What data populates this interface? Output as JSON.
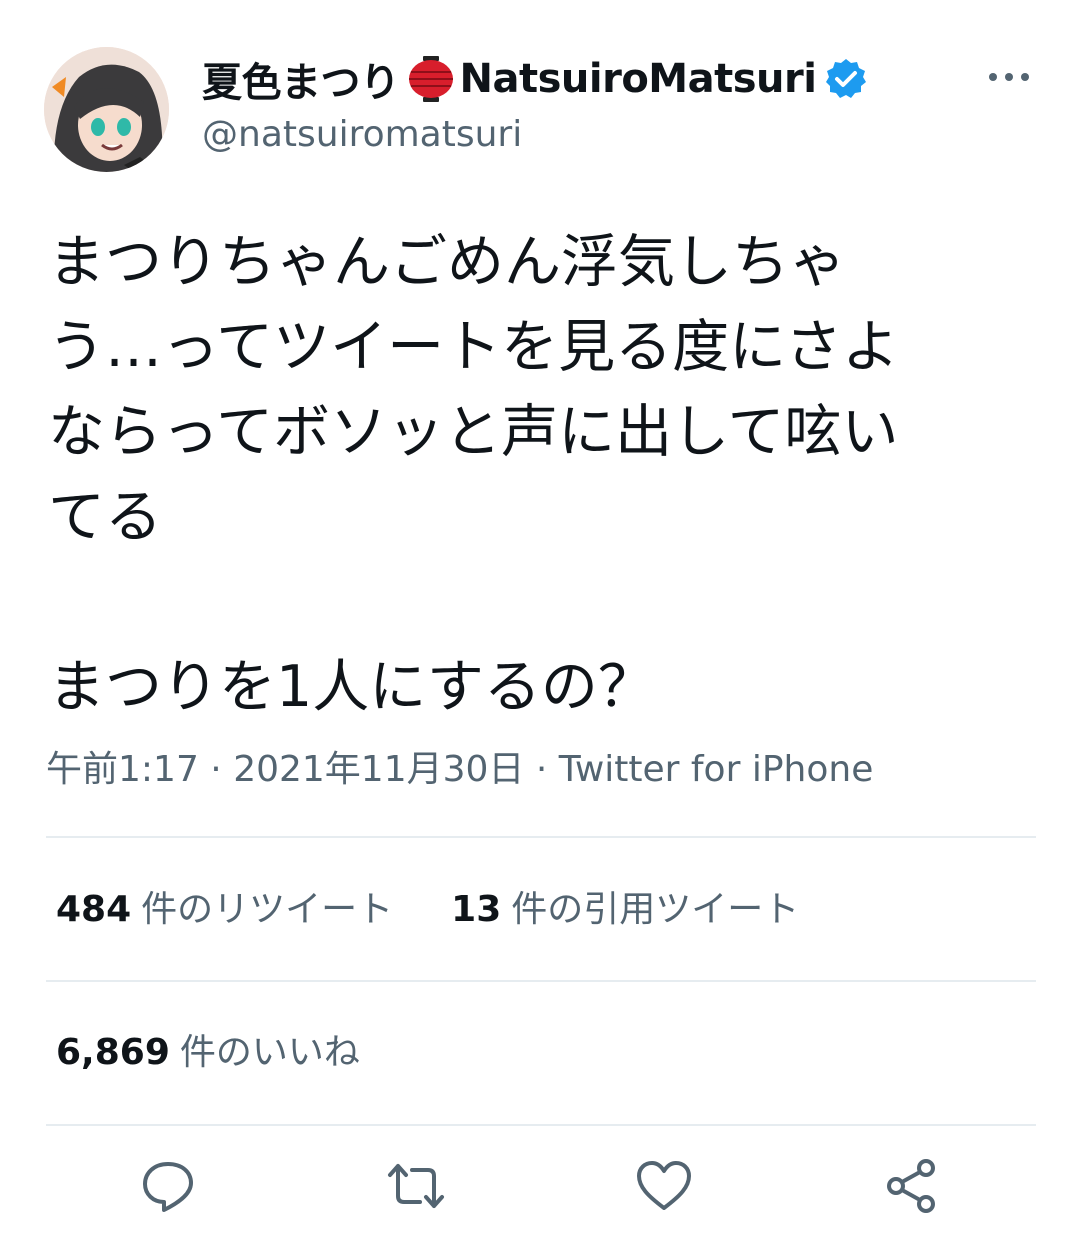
{
  "author": {
    "display_name": "夏色まつり",
    "display_name_suffix": "NatsuiroMatsuri",
    "handle": "@natsuiromatsuri",
    "lantern_emoji": "lantern-icon",
    "verified_icon": "verified-badge-icon"
  },
  "tweet": {
    "text": "まつりちゃんごめん浮気しちゃ\nう…ってツイートを見る度にさよ\nならってボソッと声に出して呟い\nてる\n\nまつりを1人にするの？",
    "meta_time": "午前1:17",
    "meta_sep": " · ",
    "meta_date": "2021年11月30日",
    "meta_source": "Twitter for iPhone"
  },
  "stats": {
    "retweets_count": "484",
    "retweets_label": "件のリツイート",
    "quotes_count": "13",
    "quotes_label": "件の引用ツイート",
    "likes_count": "6,869",
    "likes_label": "件のいいね"
  },
  "actions": [
    "reply-icon",
    "retweet-icon",
    "like-icon",
    "share-icon"
  ],
  "colors": {
    "text": "#0f1419",
    "muted": "#536471",
    "verified": "#1d9bf0",
    "divider": "#e6ecf0",
    "lantern_red": "#d81e2c"
  }
}
